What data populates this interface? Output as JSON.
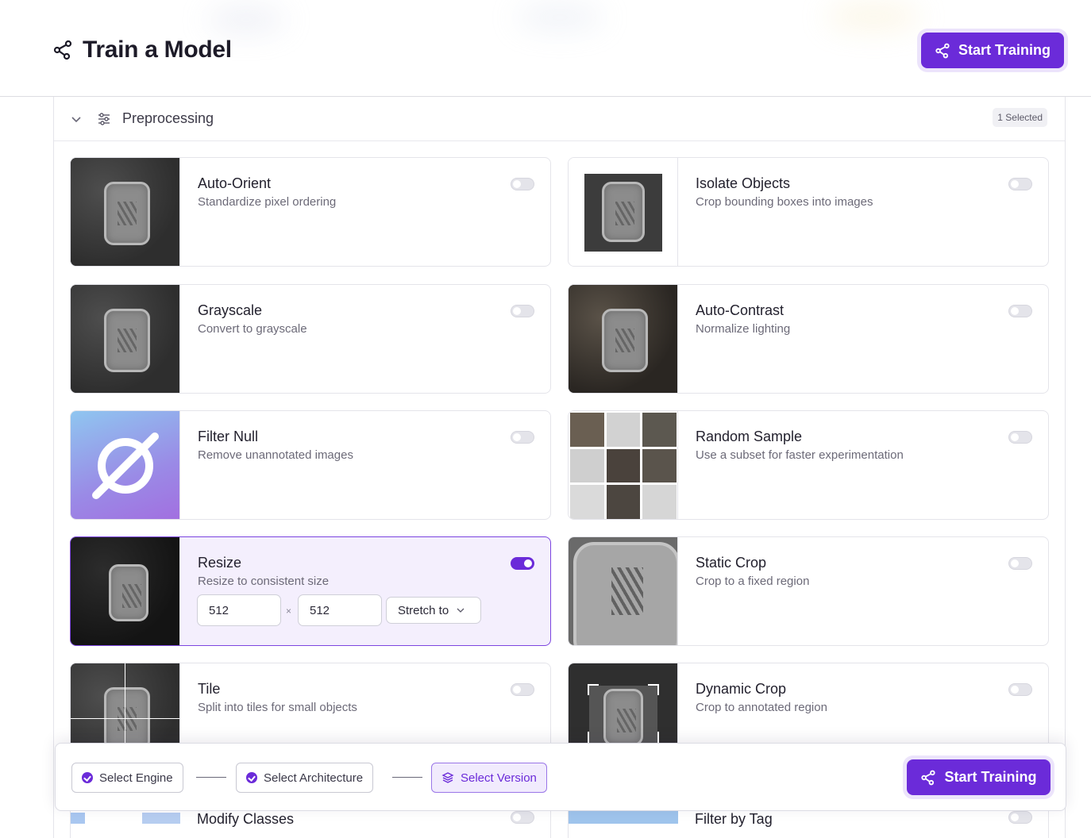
{
  "header": {
    "title": "Train a Model",
    "title_icon": "share-nodes-icon",
    "start_training_label": "Start Training"
  },
  "section": {
    "label": "Preprocessing",
    "badge": "1 Selected"
  },
  "options": [
    {
      "title": "Auto-Orient",
      "desc": "Standardize pixel ordering",
      "enabled": false
    },
    {
      "title": "Isolate Objects",
      "desc": "Crop bounding boxes into images",
      "enabled": false
    },
    {
      "title": "Grayscale",
      "desc": "Convert to grayscale",
      "enabled": false
    },
    {
      "title": "Auto-Contrast",
      "desc": "Normalize lighting",
      "enabled": false
    },
    {
      "title": "Filter Null",
      "desc": "Remove unannotated images",
      "enabled": false
    },
    {
      "title": "Random Sample",
      "desc": "Use a subset for faster experimentation",
      "enabled": false
    },
    {
      "title": "Resize",
      "desc": "Resize to consistent size",
      "enabled": true
    },
    {
      "title": "Static Crop",
      "desc": "Crop to a fixed region",
      "enabled": false
    },
    {
      "title": "Tile",
      "desc": "Split into tiles for small objects",
      "enabled": false
    },
    {
      "title": "Dynamic Crop",
      "desc": "Crop to annotated region",
      "enabled": false
    },
    {
      "title": "Modify Classes",
      "desc": "",
      "enabled": false
    },
    {
      "title": "Filter by Tag",
      "desc": "",
      "enabled": false
    }
  ],
  "resize": {
    "width": "512",
    "height": "512",
    "times": "×",
    "mode": "Stretch to"
  },
  "steps": {
    "engine": "Select Engine",
    "architecture": "Select Architecture",
    "version": "Select Version"
  },
  "footer": {
    "start_training_label": "Start Training"
  },
  "colors": {
    "accent": "#6b2bd9",
    "selected_bg": "#f4effd"
  }
}
